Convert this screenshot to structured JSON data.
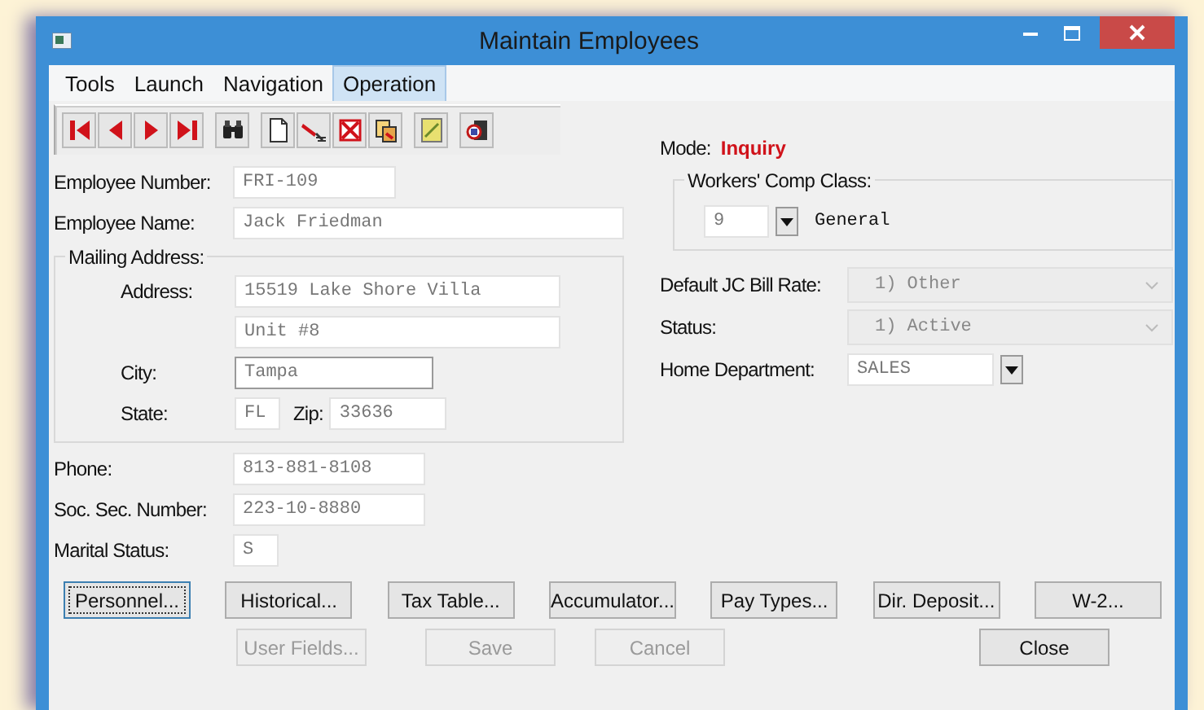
{
  "window": {
    "title": "Maintain Employees"
  },
  "menu": [
    {
      "label": "Tools",
      "selected": false
    },
    {
      "label": "Launch",
      "selected": false
    },
    {
      "label": "Navigation",
      "selected": false
    },
    {
      "label": "Operation",
      "selected": true
    }
  ],
  "mode": {
    "label": "Mode:",
    "value": "Inquiry"
  },
  "employee_number": {
    "label": "Employee Number:",
    "value": "FRI-109"
  },
  "employee_name": {
    "label": "Employee Name:",
    "value": "Jack Friedman"
  },
  "mailing_address": {
    "title": "Mailing Address:",
    "address": {
      "label": "Address:",
      "line_1": "15519 Lake Shore Villa",
      "line_2": "Unit #8"
    },
    "city": {
      "label": "City:",
      "value": "Tampa"
    },
    "state": {
      "label": "State:",
      "value": "FL"
    },
    "zip": {
      "label": "Zip:",
      "value": "33636"
    }
  },
  "phone": {
    "label": "Phone:",
    "value": "813-881-8108"
  },
  "ssn": {
    "label": "Soc. Sec. Number:",
    "value": "223-10-8880"
  },
  "marital_status": {
    "label": "Marital Status:",
    "value": "S"
  },
  "workers_comp": {
    "title": "Workers' Comp Class:",
    "code": "9",
    "description": "General"
  },
  "default_jc_bill_rate": {
    "label": "Default JC Bill Rate:",
    "value": "1) Other",
    "disabled": true
  },
  "status": {
    "label": "Status:",
    "value": "1) Active",
    "disabled": true
  },
  "home_department": {
    "label": "Home Department:",
    "value": "SALES"
  },
  "button_rows": [
    [
      {
        "label": "Personnel...",
        "disabled": false,
        "focused": true
      },
      {
        "label": "Historical...",
        "disabled": false,
        "focused": false
      },
      {
        "label": "Tax Table...",
        "disabled": false,
        "focused": false
      },
      {
        "label": "Accumulator...",
        "disabled": false,
        "focused": false
      },
      {
        "label": "Pay Types...",
        "disabled": false,
        "focused": false
      },
      {
        "label": "Dir. Deposit...",
        "disabled": false,
        "focused": false
      },
      {
        "label": "W-2...",
        "disabled": false,
        "focused": false
      }
    ],
    [
      {
        "label": "User Fields...",
        "disabled": true,
        "focused": false
      },
      {
        "label": "Save",
        "disabled": true,
        "focused": false
      },
      {
        "label": "Cancel",
        "disabled": true,
        "focused": false
      },
      {
        "label": "Close",
        "disabled": false,
        "focused": false
      }
    ]
  ]
}
